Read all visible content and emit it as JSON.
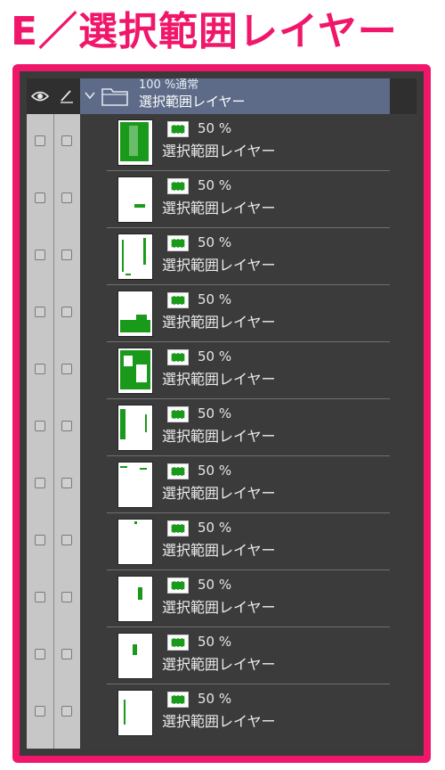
{
  "title": "E／選択範囲レイヤー",
  "panel": {
    "header": {
      "eye_icon": "eye-icon",
      "pen_icon": "pen-icon"
    },
    "folder": {
      "opacity_mode": "100 %通常",
      "name": "選択範囲レイヤー"
    },
    "layers": [
      {
        "opacity": "50 %",
        "name": "選択範囲レイヤー"
      },
      {
        "opacity": "50 %",
        "name": "選択範囲レイヤー"
      },
      {
        "opacity": "50 %",
        "name": "選択範囲レイヤー"
      },
      {
        "opacity": "50 %",
        "name": "選択範囲レイヤー"
      },
      {
        "opacity": "50 %",
        "name": "選択範囲レイヤー"
      },
      {
        "opacity": "50 %",
        "name": "選択範囲レイヤー"
      },
      {
        "opacity": "50 %",
        "name": "選択範囲レイヤー"
      },
      {
        "opacity": "50 %",
        "name": "選択範囲レイヤー"
      },
      {
        "opacity": "50 %",
        "name": "選択範囲レイヤー"
      },
      {
        "opacity": "50 %",
        "name": "選択範囲レイヤー"
      },
      {
        "opacity": "50 %",
        "name": "選択範囲レイヤー"
      }
    ]
  },
  "colors": {
    "accent": "#f0176b",
    "selection_green": "#1a9a1a",
    "folder_row": "#5d6b88",
    "panel_bg": "#3b3b3b"
  }
}
